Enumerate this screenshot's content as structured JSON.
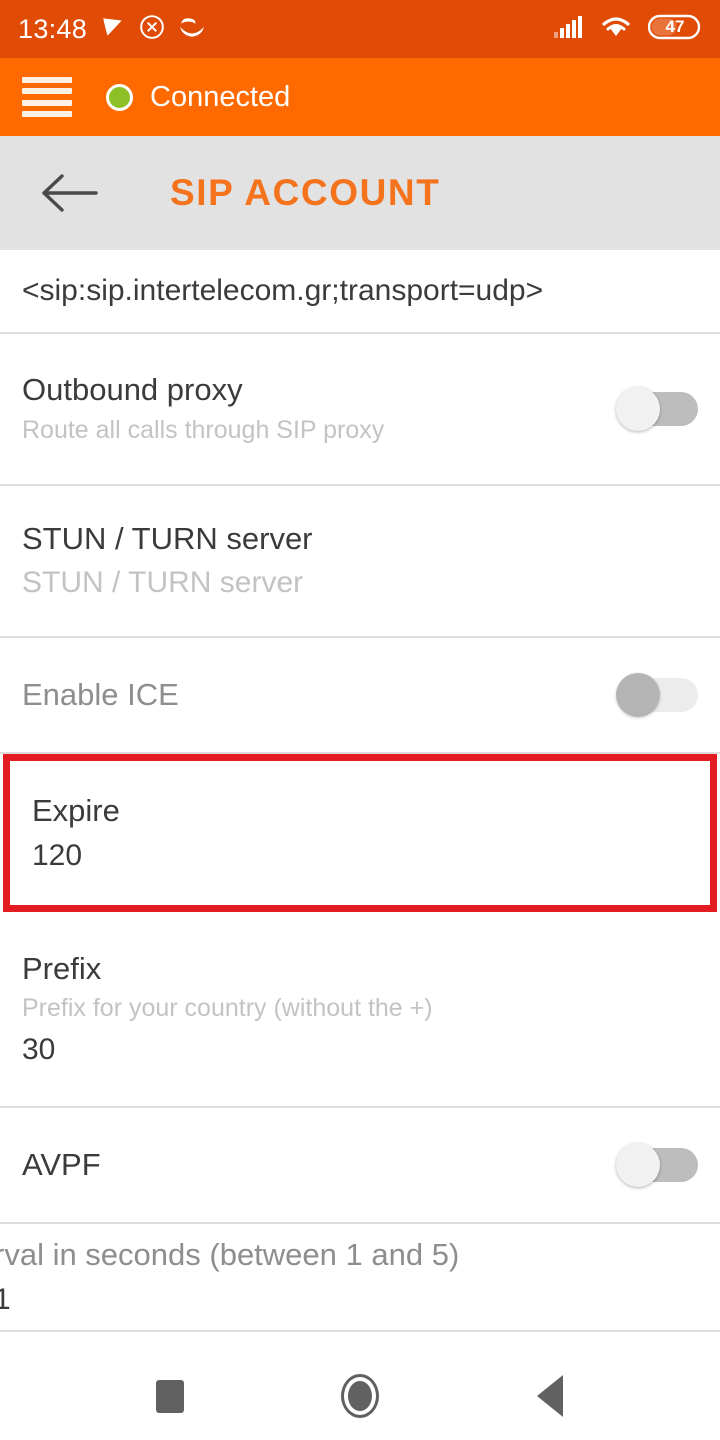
{
  "status_bar": {
    "time": "13:48",
    "battery_percent": "47",
    "left_icons": [
      "notification-flag-icon",
      "circle-x-icon",
      "smiley-icon"
    ],
    "right_icons": [
      "cellular-signal-icon",
      "wifi-icon",
      "battery-icon"
    ],
    "background_color": "#e04c06"
  },
  "app_bar": {
    "menu_icon": "hamburger-menu-icon",
    "status_label": "Connected",
    "status_dot_color": "#8dc026",
    "background_color": "#ff6a00"
  },
  "title_bar": {
    "back_icon": "back-arrow-icon",
    "title": "SIP ACCOUNT",
    "title_color": "#f4731c",
    "background_color": "#e2e2e2"
  },
  "highlight_color": "#e31c23",
  "settings": {
    "uri_row": {
      "text": "<sip:sip.intertelecom.gr;transport=udp>"
    },
    "outbound_proxy": {
      "title": "Outbound proxy",
      "subtitle": "Route all calls through SIP proxy",
      "toggle_state": "off"
    },
    "stun_turn": {
      "title": "STUN / TURN server",
      "subtitle": "STUN / TURN server"
    },
    "enable_ice": {
      "title": "Enable ICE",
      "toggle_state": "off-disabled"
    },
    "expire": {
      "title": "Expire",
      "value": "120",
      "highlighted": true
    },
    "prefix": {
      "title": "Prefix",
      "subtitle": "Prefix for your country (without the +)",
      "value": "30"
    },
    "avpf": {
      "title": "AVPF",
      "toggle_state": "off"
    },
    "avpf_interval": {
      "title": "rval in seconds (between 1 and 5)",
      "value": "1"
    }
  },
  "nav_bar": {
    "recents_icon": "square-recents-icon",
    "home_icon": "circle-home-icon",
    "back_icon": "triangle-back-icon"
  }
}
